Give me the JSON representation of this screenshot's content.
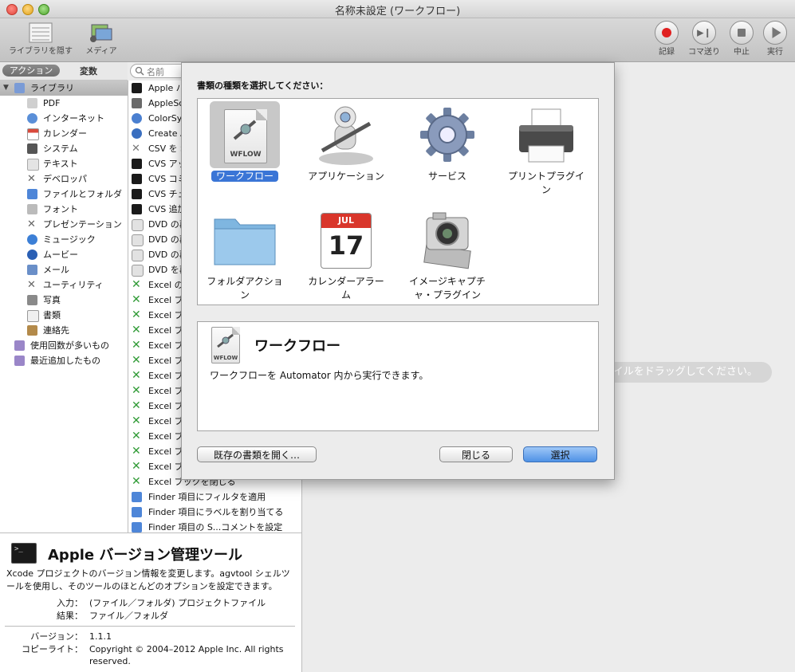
{
  "window": {
    "title": "名称未設定 (ワークフロー)"
  },
  "toolbar": {
    "left": [
      {
        "label": "ライブラリを隠す",
        "icon": "library-icon"
      },
      {
        "label": "メディア",
        "icon": "media-icon"
      }
    ],
    "right": [
      {
        "label": "記録",
        "icon": "record-icon"
      },
      {
        "label": "コマ送り",
        "icon": "step-icon"
      },
      {
        "label": "中止",
        "icon": "stop-icon"
      },
      {
        "label": "実行",
        "icon": "run-icon"
      }
    ]
  },
  "library": {
    "segments": {
      "actions": "アクション",
      "variables": "変数"
    },
    "search_placeholder": "名前",
    "tree": [
      {
        "label": "ライブラリ",
        "icon": "library-icon",
        "color": "#7a9bd6"
      },
      {
        "label": "PDF",
        "icon": "pdf-icon",
        "color": "#cfcfcf"
      },
      {
        "label": "インターネット",
        "icon": "globe-icon",
        "color": "#5a8fd8"
      },
      {
        "label": "カレンダー",
        "icon": "calendar-icon",
        "color": "#d94a3c"
      },
      {
        "label": "システム",
        "icon": "system-icon",
        "color": "#555555"
      },
      {
        "label": "テキスト",
        "icon": "text-icon",
        "color": "#d8d8d8"
      },
      {
        "label": "デベロッパ",
        "icon": "tools-icon",
        "color": "#777777"
      },
      {
        "label": "ファイルとフォルダ",
        "icon": "finder-icon",
        "color": "#4e86d8"
      },
      {
        "label": "フォント",
        "icon": "font-icon",
        "color": "#bbbbbb"
      },
      {
        "label": "プレゼンテーション",
        "icon": "tools-icon",
        "color": "#777777"
      },
      {
        "label": "ミュージック",
        "icon": "music-icon",
        "color": "#3c7fd6"
      },
      {
        "label": "ムービー",
        "icon": "movie-icon",
        "color": "#2a5fb4"
      },
      {
        "label": "メール",
        "icon": "mail-icon",
        "color": "#6a8fc8"
      },
      {
        "label": "ユーティリティ",
        "icon": "tools-icon",
        "color": "#777777"
      },
      {
        "label": "写真",
        "icon": "photo-icon",
        "color": "#8a8a8a"
      },
      {
        "label": "書類",
        "icon": "document-icon",
        "color": "#e5e5e5"
      },
      {
        "label": "連絡先",
        "icon": "contacts-icon",
        "color": "#b38a4a"
      },
      {
        "label": "使用回数が多いもの",
        "icon": "smart-folder-icon",
        "color": "#9a86c8"
      },
      {
        "label": "最近追加したもの",
        "icon": "smart-folder-icon",
        "color": "#9a86c8"
      }
    ]
  },
  "actions": [
    {
      "label": "Apple バ",
      "icon": "terminal-icon",
      "color": "#1a1a1a"
    },
    {
      "label": "AppleSc",
      "icon": "script-icon",
      "color": "#6a6a6a"
    },
    {
      "label": "ColorSy",
      "icon": "colorsync-icon",
      "color": "#4a7fd0"
    },
    {
      "label": "Create A",
      "icon": "magnifier-icon",
      "color": "#3a6fc0"
    },
    {
      "label": "CSV を S",
      "icon": "tools-icon",
      "color": "#777777"
    },
    {
      "label": "CVS アッ",
      "icon": "terminal-icon",
      "color": "#1a1a1a"
    },
    {
      "label": "CVS コミ",
      "icon": "terminal-icon",
      "color": "#1a1a1a"
    },
    {
      "label": "CVS チェ",
      "icon": "terminal-icon",
      "color": "#1a1a1a"
    },
    {
      "label": "CVS 追加",
      "icon": "terminal-icon",
      "color": "#1a1a1a"
    },
    {
      "label": "DVD の再",
      "icon": "dvd-icon",
      "color": "#9a9a9a"
    },
    {
      "label": "DVD の再",
      "icon": "dvd-icon",
      "color": "#9a9a9a"
    },
    {
      "label": "DVD の再",
      "icon": "dvd-icon",
      "color": "#9a9a9a"
    },
    {
      "label": "DVD を再",
      "icon": "dvd-icon",
      "color": "#9a9a9a"
    },
    {
      "label": "Excel の",
      "icon": "excel-icon",
      "color": "#2f9a35"
    },
    {
      "label": "Excel ブ",
      "icon": "excel-icon",
      "color": "#2f9a35"
    },
    {
      "label": "Excel ブ",
      "icon": "excel-icon",
      "color": "#2f9a35"
    },
    {
      "label": "Excel ブ",
      "icon": "excel-icon",
      "color": "#2f9a35"
    },
    {
      "label": "Excel ブ",
      "icon": "excel-icon",
      "color": "#2f9a35"
    },
    {
      "label": "Excel ブ",
      "icon": "excel-icon",
      "color": "#2f9a35"
    },
    {
      "label": "Excel ブ",
      "icon": "excel-icon",
      "color": "#2f9a35"
    },
    {
      "label": "Excel ブ",
      "icon": "excel-icon",
      "color": "#2f9a35"
    },
    {
      "label": "Excel ブ",
      "icon": "excel-icon",
      "color": "#2f9a35"
    },
    {
      "label": "Excel ブ",
      "icon": "excel-icon",
      "color": "#2f9a35"
    },
    {
      "label": "Excel ブ",
      "icon": "excel-icon",
      "color": "#2f9a35"
    },
    {
      "label": "Excel ブ",
      "icon": "excel-icon",
      "color": "#2f9a35"
    },
    {
      "label": "Excel ブ",
      "icon": "excel-icon",
      "color": "#2f9a35"
    },
    {
      "label": "Excel ブックを閉じる",
      "icon": "excel-icon",
      "color": "#2f9a35"
    },
    {
      "label": "Finder 項目にフィルタを適用",
      "icon": "finder-icon",
      "color": "#4e86d8"
    },
    {
      "label": "Finder 項目にラベルを割り当てる",
      "icon": "finder-icon",
      "color": "#4e86d8"
    },
    {
      "label": "Finder 項目の S...コメントを設定",
      "icon": "finder-icon",
      "color": "#4e86d8"
    }
  ],
  "description": {
    "title": "Apple バージョン管理ツール",
    "text": "Xcode プロジェクトのバージョン情報を変更します。agvtool シェルツールを使用し、そのツールのほとんどのオプションを設定できます。",
    "input_key": "入力：",
    "input_val": "(ファイル／フォルダ) プロジェクトファイル",
    "result_key": "結果：",
    "result_val": "ファイル／フォルダ",
    "version_key": "バージョン：",
    "version_val": "1.1.1",
    "copyright_key": "コピーライト：",
    "copyright_val": "Copyright © 2004–2012 Apple Inc.  All rights reserved."
  },
  "workarea": {
    "drop_hint": "ァイルをドラッグしてください。"
  },
  "sheet": {
    "prompt": "書類の種類を選択してください：",
    "types": [
      {
        "label": "ワークフロー",
        "icon": "workflow-icon",
        "selected": true
      },
      {
        "label": "アプリケーション",
        "icon": "automator-robot-icon",
        "selected": false
      },
      {
        "label": "サービス",
        "icon": "gear-icon",
        "selected": false
      },
      {
        "label": "プリントプラグイン",
        "icon": "printer-icon",
        "selected": false
      },
      {
        "label": "フォルダアクション",
        "icon": "folder-icon",
        "selected": false
      },
      {
        "label": "カレンダーアラーム",
        "icon": "calendar-icon",
        "selected": false,
        "calendar_month": "JUL",
        "calendar_day": "17"
      },
      {
        "label": "イメージキャプチャ・プラグイン",
        "icon": "camera-icon",
        "selected": false
      }
    ],
    "info": {
      "title": "ワークフロー",
      "text": "ワークフローを Automator 内から実行できます。",
      "doc_label": "WFLOW"
    },
    "buttons": {
      "open": "既存の書類を開く…",
      "close": "閉じる",
      "select": "選択"
    },
    "colors": {
      "selection": "#3a75d6",
      "default_button": "#4f92e6"
    }
  }
}
